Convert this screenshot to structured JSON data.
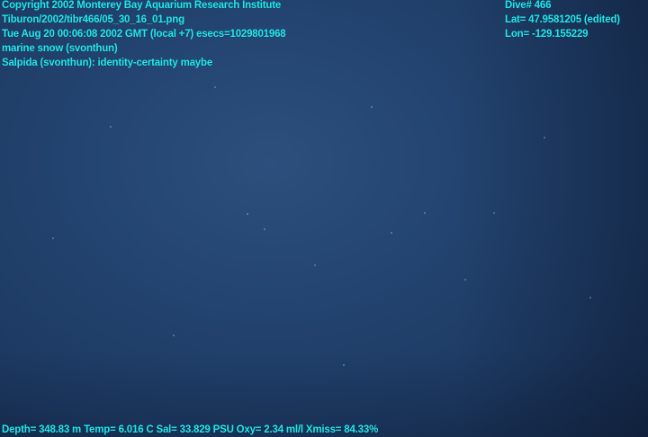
{
  "header_left": {
    "copyright": "Copyright 2002 Monterey Bay Aquarium Research Institute",
    "file_path": "Tiburon/2002/tibr466/05_30_16_01.png",
    "timestamp": "Tue Aug 20 00:06:08 2002 GMT (local +7)  esecs=1029801968",
    "annotation_1": "marine snow (svonthun)",
    "annotation_2": "Salpida (svonthun): identity-certainty maybe"
  },
  "header_right": {
    "dive": "Dive# 466",
    "latitude": "Lat= 47.9581205 (edited)",
    "longitude": "Lon= -129.155229"
  },
  "footer": {
    "telemetry": "Depth= 348.83 m  Temp= 6.016 C  Sal= 33.829 PSU  Oxy= 2.34 ml/l  Xmiss= 84.33%"
  },
  "colors": {
    "overlay_text": "#22e8ee",
    "water": "#234470"
  }
}
